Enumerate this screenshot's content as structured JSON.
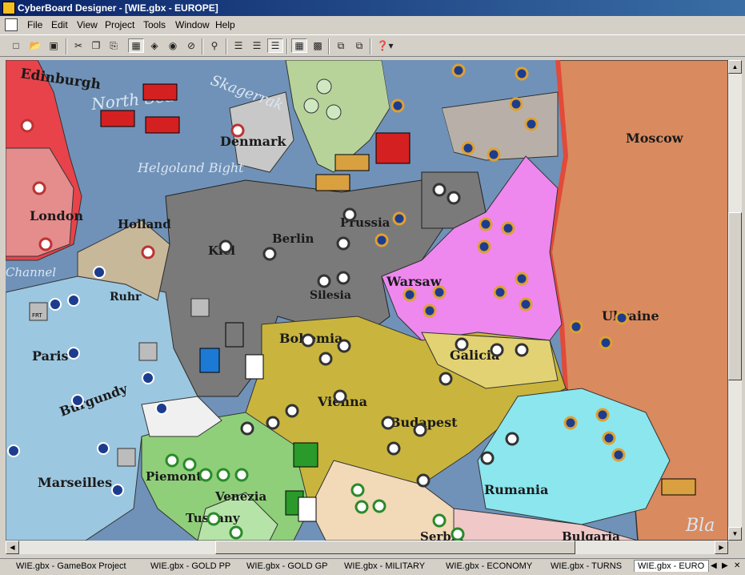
{
  "window": {
    "title": "CyberBoard Designer - [WIE.gbx - EUROPE]"
  },
  "menu": [
    "File",
    "Edit",
    "View",
    "Project",
    "Tools",
    "Window",
    "Help"
  ],
  "toolbar": {
    "icons": [
      "new-document",
      "open-folder",
      "save",
      "cut",
      "copy",
      "paste",
      "select",
      "unknown",
      "unknown",
      "unknown",
      "zoom",
      "layers-1",
      "layers-2",
      "layers-3",
      "grid",
      "grid-fine",
      "stack-1",
      "stack-2",
      "help"
    ]
  },
  "map": {
    "places": {
      "edinburgh": "Edinburgh",
      "north_sea": "North Sea",
      "skagerrak": "Skagerrak",
      "denmark": "Denmark",
      "helgoland_bight": "Helgoland Bight",
      "moscow": "Moscow",
      "kiel": "Kiel",
      "berlin": "Berlin",
      "prussia": "Prussia",
      "holland": "Holland",
      "london": "London",
      "warsaw": "Warsaw",
      "ukraine": "Ukraine",
      "bohemia": "Bohemia",
      "vienna": "Vienna",
      "budapest": "Budapest",
      "paris": "Paris",
      "burgundy": "Burgundy",
      "marseilles": "Marseilles",
      "piemonte": "Piemonte",
      "venezia": "Venezia",
      "tuscany": "Tuscany",
      "rumania": "Rumania",
      "galicia": "Galicia",
      "channel": "Channel",
      "silesia": "Silesia",
      "black_sea": "Bla",
      "bulgaria": "Bulgaria",
      "serbia": "Serbia",
      "ruhr": "Ruhr",
      "frt": "FRT"
    }
  },
  "tabs": [
    {
      "label": "WIE.gbx - GameBox Project",
      "active": false
    },
    {
      "label": "WIE.gbx - GOLD PP",
      "active": false
    },
    {
      "label": "WIE.gbx - GOLD GP",
      "active": false
    },
    {
      "label": "WIE.gbx - MILITARY",
      "active": false
    },
    {
      "label": "WIE.gbx - ECONOMY",
      "active": false
    },
    {
      "label": "WIE.gbx - TURNS",
      "active": false
    },
    {
      "label": "WIE.gbx - EURO",
      "active": true
    }
  ]
}
